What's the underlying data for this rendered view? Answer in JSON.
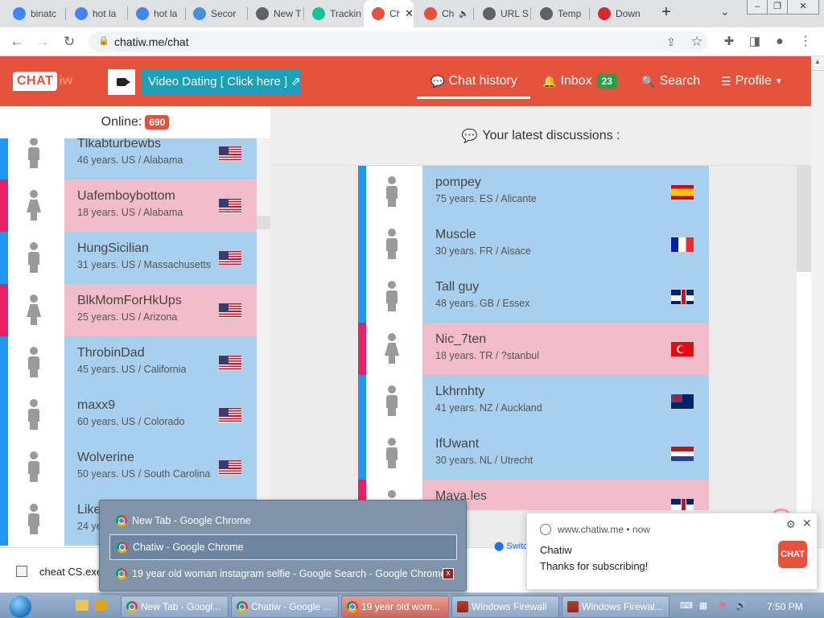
{
  "browser": {
    "tabs": [
      {
        "label": "binatc",
        "icon": "google-icon",
        "color": "#4285f4"
      },
      {
        "label": "hot la",
        "icon": "google-icon",
        "color": "#4285f4"
      },
      {
        "label": "hot la",
        "icon": "google-icon",
        "color": "#4285f4"
      },
      {
        "label": "Secor",
        "icon": "bug-icon",
        "color": "#4a90d9"
      },
      {
        "label": "New T",
        "icon": "globe-icon",
        "color": "#5f6368"
      },
      {
        "label": "Trackin",
        "icon": "grammarly-icon",
        "color": "#15c39a"
      },
      {
        "label": "Ch",
        "icon": "chatiw-icon",
        "color": "#e4513c"
      },
      {
        "label": "Ch",
        "icon": "chatiw-icon",
        "color": "#e4513c"
      },
      {
        "label": "URL S",
        "icon": "link-icon",
        "color": "#5f6368"
      },
      {
        "label": "Temp",
        "icon": "globe-icon",
        "color": "#5f6368"
      },
      {
        "label": "Down",
        "icon": "mega-icon",
        "color": "#d9272e"
      }
    ],
    "url": "chatiw.me/chat"
  },
  "site": {
    "logo_text": "CHAT",
    "logo_suffix": "iw",
    "video_dating": "Video Dating [ Click here ]",
    "nav": {
      "chat_history": "Chat history",
      "inbox": "Inbox",
      "inbox_count": "23",
      "search": "Search",
      "profile": "Profile"
    },
    "accent_color": "#e4513c"
  },
  "online": {
    "label": "Online:",
    "count": "690"
  },
  "online_users": [
    {
      "name": "Tlkabturbewbs",
      "meta": "46 years. US / Alabama",
      "gender": "male",
      "flag": "us"
    },
    {
      "name": "Uafemboybottom",
      "meta": "18 years. US / Alabama",
      "gender": "female",
      "flag": "us"
    },
    {
      "name": "HungSicilian",
      "meta": "31 years. US / Massachusetts",
      "gender": "male",
      "flag": "us"
    },
    {
      "name": "BlkMomForHkUps",
      "meta": "25 years. US / Arizona",
      "gender": "female",
      "flag": "us"
    },
    {
      "name": "ThrobinDad",
      "meta": "45 years. US / California",
      "gender": "male",
      "flag": "us"
    },
    {
      "name": "maxx9",
      "meta": "60 years. US / Colorado",
      "gender": "male",
      "flag": "us"
    },
    {
      "name": "Wolverine",
      "meta": "50 years. US / South Carolina",
      "gender": "male",
      "flag": "us"
    },
    {
      "name": "Like",
      "meta": "24 ye",
      "gender": "male",
      "flag": "us"
    }
  ],
  "latest_title": "Your latest discussions :",
  "discussions": [
    {
      "name": "pompey",
      "meta": "75 years. ES / Alicante",
      "gender": "male",
      "flag": "es"
    },
    {
      "name": "Muscle",
      "meta": "30 years. FR / Alsace",
      "gender": "male",
      "flag": "fr"
    },
    {
      "name": "Tall guy",
      "meta": "48 years. GB / Essex",
      "gender": "male",
      "flag": "gb"
    },
    {
      "name": "Nic_7ten",
      "meta": "18 years. TR / ?stanbul",
      "gender": "female",
      "flag": "tr"
    },
    {
      "name": "Lkhrnhty",
      "meta": "41 years. NZ / Auckland",
      "gender": "male",
      "flag": "nz"
    },
    {
      "name": "IfUwant",
      "meta": "30 years. NL / Utrecht",
      "gender": "male",
      "flag": "nl"
    },
    {
      "name": "Maya.les",
      "meta": "",
      "gender": "female",
      "flag": "gb"
    }
  ],
  "switch_link": "Switc",
  "switcher": {
    "items": [
      {
        "label": "New Tab - Google Chrome"
      },
      {
        "label": "Chatiw - Google Chrome"
      },
      {
        "label": "19 year old woman instagram selfie - Google Search - Google Chrome"
      }
    ],
    "close_glyph": "x"
  },
  "notification": {
    "source": "www.chatiw.me",
    "time": "now",
    "title": "Chatiw",
    "message": "Thanks for subscribing!",
    "logo": "CHAT"
  },
  "download": {
    "filename": "cheat CS.exe"
  },
  "taskbar": {
    "tasks": [
      {
        "label": "New Tab - Googl..."
      },
      {
        "label": "Chatiw - Google ..."
      },
      {
        "label": "19 year old wom..."
      },
      {
        "label": "Windows Firewall"
      },
      {
        "label": "Windows Firewal..."
      }
    ],
    "clock": "7:50 PM"
  }
}
